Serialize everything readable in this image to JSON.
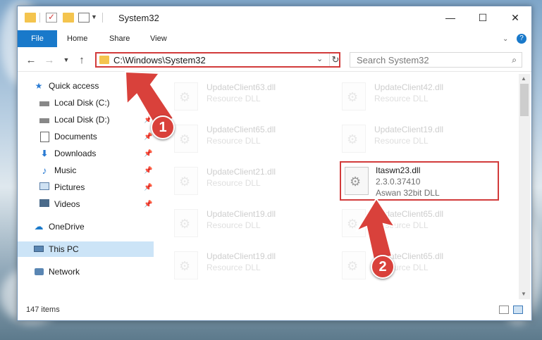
{
  "window": {
    "title": "System32",
    "controls": {
      "minimize": "—",
      "maximize": "☐",
      "close": "✕"
    }
  },
  "ribbon": {
    "file": "File",
    "tabs": [
      "Home",
      "Share",
      "View"
    ]
  },
  "address": {
    "path": "C:\\Windows\\System32",
    "search_placeholder": "Search System32"
  },
  "nav": {
    "items": [
      {
        "label": "Quick access",
        "icon": "star-icon",
        "pinned": false
      },
      {
        "label": "Local Disk (C:)",
        "icon": "drive-icon",
        "pinned": true
      },
      {
        "label": "Local Disk (D:)",
        "icon": "drive-icon",
        "pinned": true
      },
      {
        "label": "Documents",
        "icon": "documents-icon",
        "pinned": true
      },
      {
        "label": "Downloads",
        "icon": "downloads-icon",
        "pinned": true
      },
      {
        "label": "Music",
        "icon": "music-icon",
        "pinned": true
      },
      {
        "label": "Pictures",
        "icon": "pictures-icon",
        "pinned": true
      },
      {
        "label": "Videos",
        "icon": "videos-icon",
        "pinned": true
      },
      {
        "label": "OneDrive",
        "icon": "onedrive-icon",
        "pinned": false
      },
      {
        "label": "This PC",
        "icon": "pc-icon",
        "pinned": false,
        "selected": true
      },
      {
        "label": "Network",
        "icon": "network-icon",
        "pinned": false
      }
    ]
  },
  "files": {
    "left": [
      {
        "name": "UpdateClient63.dll",
        "type": "Resource DLL"
      },
      {
        "name": "UpdateClient65.dll",
        "type": "Resource DLL"
      },
      {
        "name": "UpdateClient21.dll",
        "type": "Resource DLL"
      },
      {
        "name": "UpdateClient19.dll",
        "type": "Resource DLL"
      },
      {
        "name": "UpdateClient19.dll",
        "type": "Resource DLL"
      }
    ],
    "right": [
      {
        "name": "UpdateClient42.dll",
        "type": "Resource DLL"
      },
      {
        "name": "UpdateClient19.dll",
        "type": "Resource DLL"
      },
      {
        "name": "UpdateClient65.dll",
        "type": "Resource DLL"
      },
      {
        "name": "UpdateClient65.dll",
        "type": "Resource DLL"
      }
    ],
    "highlighted": {
      "name": "Itaswn23.dll",
      "version": "2.3.0.37410",
      "description": "Aswan 32bit DLL"
    }
  },
  "status": {
    "item_count": "147 items"
  },
  "callouts": [
    "1",
    "2"
  ],
  "colors": {
    "accent": "#1979ca",
    "highlight": "#d23b3b",
    "selected": "#cce4f7"
  }
}
